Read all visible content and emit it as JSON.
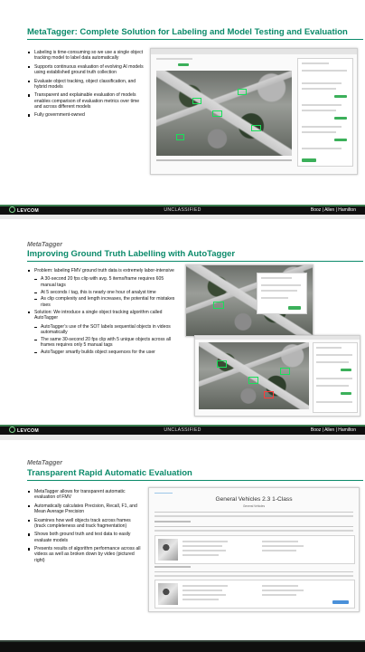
{
  "colors": {
    "accent": "#0b8a6a",
    "footer_bg": "#0f0f0f",
    "footer_stripe": "#3a7d4f",
    "tag_green": "#19e05a"
  },
  "footer": {
    "logo": "LEVCOM",
    "classification": "UNCLASSIFIED",
    "brand": "Booz | Allen | Hamilton"
  },
  "slide1": {
    "title": "MetaTagger: Complete Solution for Labeling and Model Testing and Evaluation",
    "bullets": [
      "Labeling is time-consuming so we use a single object tracking model to label data automatically",
      "Supports continuous evaluation of evolving AI models using established ground truth collection",
      "Evaluate object tracking, object classification, and hybrid models",
      "Transparent and explainable evaluation of models enables comparison of evaluation metrics over time and across different models",
      "Fully government-owned"
    ]
  },
  "slide2": {
    "kicker": "MetaTagger",
    "title": "Improving Ground Truth Labelling with AutoTagger",
    "bullets": [
      {
        "text": "Problem: labeling FMV ground truth data is extremely labor-intensive",
        "level": 1
      },
      {
        "text": "A 30-second 20 fps clip with avg. 5 items/frame requires 605 manual tags",
        "level": 2
      },
      {
        "text": "At 5 seconds / tag, this is nearly one hour of analyst time",
        "level": 2
      },
      {
        "text": "As clip complexity and length increases, the potential for mistakes rises",
        "level": 2
      },
      {
        "text": "Solution: We introduce a single object tracking algorithm called AutoTagger",
        "level": 1
      },
      {
        "text": "AutoTagger’s use of the SOT labels sequential objects in videos automatically",
        "level": 2
      },
      {
        "text": "The same 30-second 20 fps clip with 5 unique objects across all frames requires only 5 manual tags",
        "level": 2
      },
      {
        "text": "AutoTagger smartly builds object sequences for the user",
        "level": 2
      }
    ]
  },
  "slide3": {
    "kicker": "MetaTagger",
    "title": "Transparent Rapid Automatic Evaluation",
    "bullets": [
      "MetaTagger allows for transparent automatic evaluation of FMV",
      "Automatically calculates Precision, Recall, F1, and Mean Average Precision",
      "Examines how well objects track across frames (track completeness and track fragmentation)",
      "Shows both ground truth and test data to easily evaluate models",
      "Presents results of algorithm performance across all videos as well as broken down by video (pictured right)"
    ],
    "screenshot": {
      "title": "General Vehicles 2.3 1-Class",
      "subtitle": "General Vehicles"
    }
  }
}
